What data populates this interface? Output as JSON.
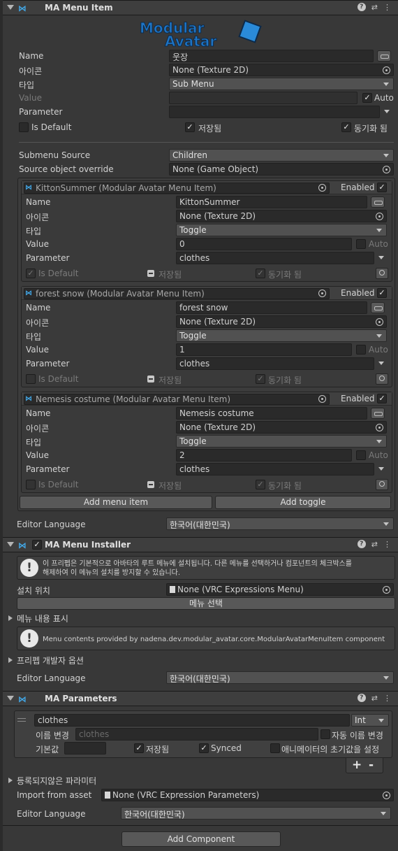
{
  "menu_item": {
    "title": "MA Menu Item",
    "logo_line1": "Modular",
    "logo_line2": "Avatar",
    "name_label": "Name",
    "name_value": "웃장",
    "icon_label": "아이콘",
    "icon_value": "None (Texture 2D)",
    "type_label": "타입",
    "type_value": "Sub Menu",
    "value_label": "Value",
    "auto_label": "Auto",
    "parameter_label": "Parameter",
    "is_default_label": "Is Default",
    "saved_label": "저장됨",
    "synced_label": "동기화 됨",
    "submenu_source_label": "Submenu Source",
    "submenu_source_value": "Children",
    "source_override_label": "Source object override",
    "source_override_value": "None (Game Object)",
    "add_menu_item": "Add menu item",
    "add_toggle": "Add toggle",
    "editor_language_label": "Editor Language",
    "editor_language_value": "한국어(대한민국)"
  },
  "children": [
    {
      "header": "KittonSummer (Modular Avatar Menu Item)",
      "enabled": "Enabled",
      "name": "KittonSummer",
      "icon": "None (Texture 2D)",
      "type": "Toggle",
      "value": "0",
      "parameter": "clothes",
      "is_default_checked": true
    },
    {
      "header": "forest snow (Modular Avatar Menu Item)",
      "enabled": "Enabled",
      "name": "forest snow",
      "icon": "None (Texture 2D)",
      "type": "Toggle",
      "value": "1",
      "parameter": "clothes",
      "is_default_checked": false
    },
    {
      "header": "Nemesis costume (Modular Avatar Menu Item)",
      "enabled": "Enabled",
      "name": "Nemesis costume",
      "icon": "None (Texture 2D)",
      "type": "Toggle",
      "value": "2",
      "parameter": "clothes",
      "is_default_checked": false
    }
  ],
  "child_labels": {
    "name": "Name",
    "icon": "아이콘",
    "type": "타입",
    "value": "Value",
    "auto": "Auto",
    "parameter": "Parameter",
    "is_default": "Is Default",
    "saved": "저장됨",
    "synced": "동기화 됨"
  },
  "installer": {
    "title": "MA Menu Installer",
    "help1_line1": "이 프리펩은 기본적으로 아바타의 루트 메뉴에 설치됩니다. 다른 메뉴를 선택하거나 컴포넌트의 체크박스를",
    "help1_line2": "해제하여 이 메뉴의 설치를 방지할 수 있습니다.",
    "install_location_label": "설치 위치",
    "install_location_value": "None (VRC Expressions Menu)",
    "select_menu_button": "메뉴 선택",
    "show_contents_label": "메뉴 내용 표시",
    "help2": "Menu contents provided by nadena.dev.modular_avatar.core.ModularAvatarMenuItem component",
    "developer_options_label": "프리펩 개발자 옵션",
    "editor_language_label": "Editor Language",
    "editor_language_value": "한국어(대한민국)"
  },
  "parameters": {
    "title": "MA Parameters",
    "param_name": "clothes",
    "param_type": "Int",
    "rename_label": "이름 변경",
    "rename_placeholder": "clothes",
    "auto_rename_label": "자동 이름 변경",
    "default_label": "기본값",
    "saved_label": "저장됨",
    "synced_label": "Synced",
    "animator_default_label": "애니메이터의 초기값을 설정",
    "plus": "+",
    "minus": "-",
    "unregistered_label": "등록되지않은 파라미터",
    "import_label": "Import from asset",
    "import_value": "None (VRC Expression Parameters)",
    "editor_language_label": "Editor Language",
    "editor_language_value": "한국어(대한민국)"
  },
  "add_component_button": "Add Component",
  "colors": {
    "background": "#383838",
    "field": "#2a2a2a",
    "accent": "#42a8e8"
  }
}
